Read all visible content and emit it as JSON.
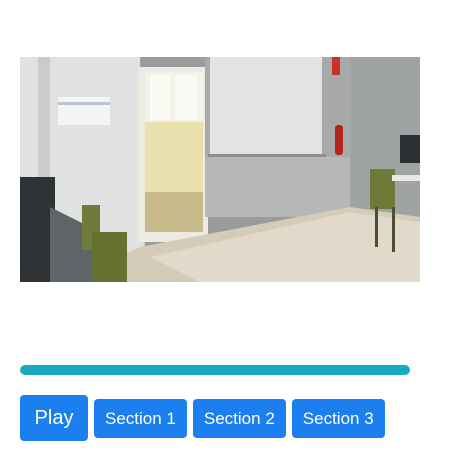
{
  "video": {
    "description_icon": "video-frame-classroom"
  },
  "progress": {
    "fraction": 1.0,
    "color": "#17a9bf"
  },
  "controls": {
    "play_label": "Play",
    "sections": [
      {
        "label": "Section 1"
      },
      {
        "label": "Section 2"
      },
      {
        "label": "Section 3"
      }
    ],
    "button_color": "#1b7ff0"
  }
}
